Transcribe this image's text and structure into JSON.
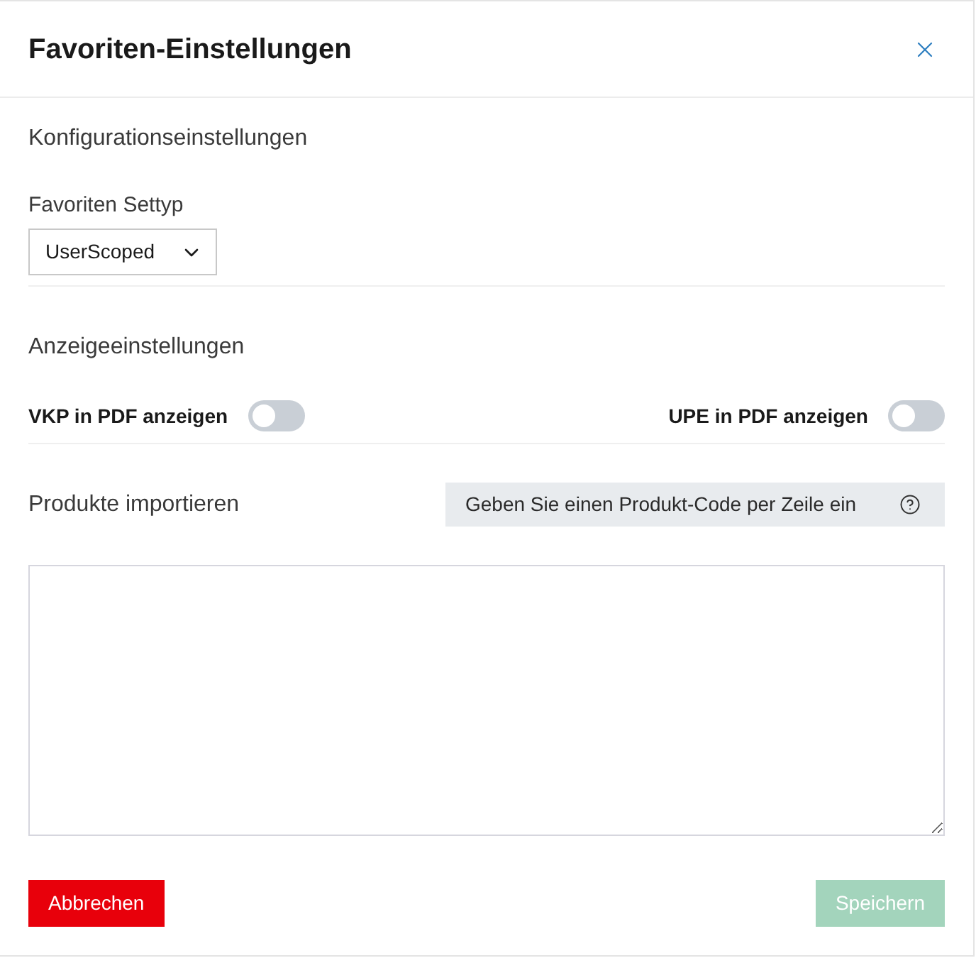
{
  "dialog": {
    "title": "Favoriten-Einstellungen"
  },
  "configuration": {
    "heading": "Konfigurationseinstellungen",
    "settype": {
      "label": "Favoriten Settyp",
      "value": "UserScoped"
    }
  },
  "display": {
    "heading": "Anzeigeeinstellungen",
    "toggles": [
      {
        "label": "VKP in PDF anzeigen",
        "on": false
      },
      {
        "label": "UPE in PDF anzeigen",
        "on": false
      }
    ]
  },
  "import": {
    "label": "Produkte importieren",
    "hint": "Geben Sie einen Produkt-Code per Zeile ein"
  },
  "buttons": [
    {
      "label": "Abbrechen",
      "kind": "cancel",
      "disabled": false
    },
    {
      "label": "Speichern",
      "kind": "save",
      "disabled": true
    }
  ]
}
